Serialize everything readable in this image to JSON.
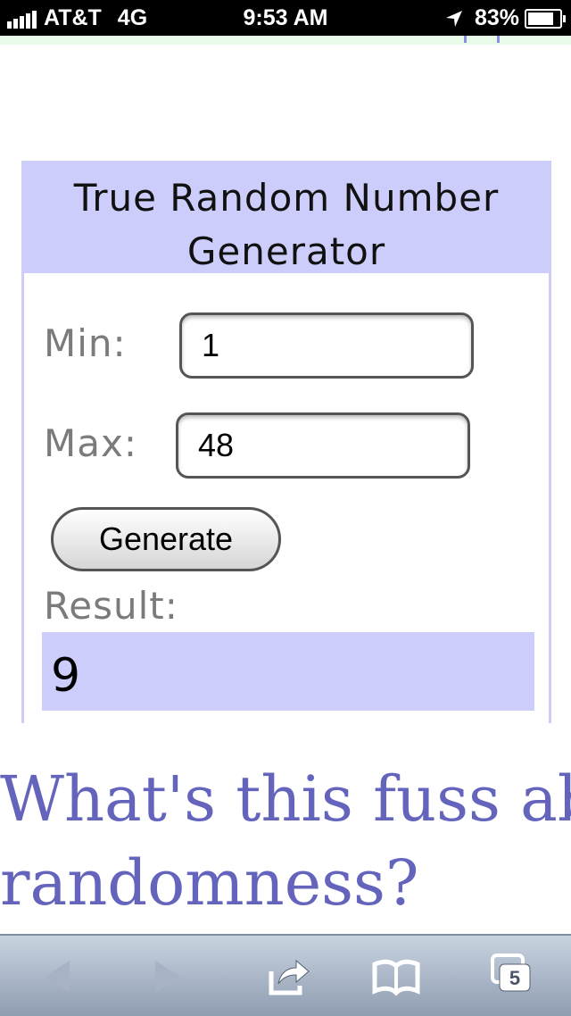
{
  "status_bar": {
    "carrier": "AT&T",
    "network": "4G",
    "time": "9:53 AM",
    "battery": "83%",
    "battery_level": 0.83,
    "signal_bars": 5
  },
  "widget": {
    "title": "True Random Number Generator",
    "min_label": "Min:",
    "min_value": "1",
    "max_label": "Max:",
    "max_value": "48",
    "generate_label": "Generate",
    "result_label": "Result:",
    "result_value": "9"
  },
  "heading": {
    "line1": "What's this fuss about",
    "line2": "randomness?"
  },
  "toolbar": {
    "tab_count": "5",
    "icons": [
      "back-icon",
      "forward-icon",
      "share-icon",
      "bookmarks-icon",
      "tabs-icon"
    ]
  },
  "colors": {
    "header_bg": "#cdcdfb",
    "heading_text": "#6464bd",
    "label_text": "#7b7b7b"
  }
}
